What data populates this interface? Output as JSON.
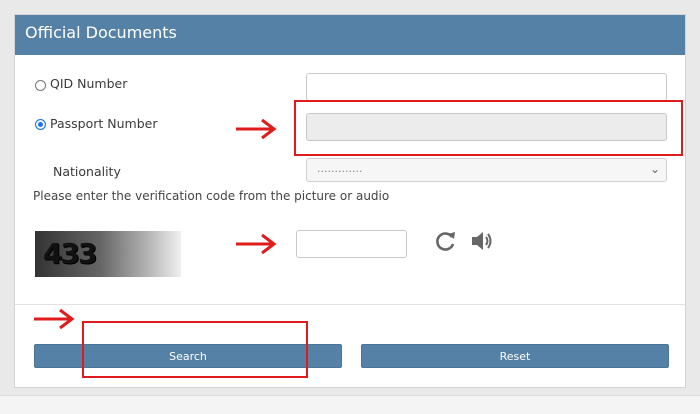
{
  "header": {
    "title": "Official Documents"
  },
  "form": {
    "options": [
      {
        "label": "QID Number",
        "selected": false
      },
      {
        "label": "Passport Number",
        "selected": true
      }
    ],
    "nationality": {
      "label": "Nationality",
      "selected_value": "............."
    },
    "verification_hint": "Please enter the verification code from the picture or audio",
    "captcha_text": "433"
  },
  "icons": {
    "refresh": "refresh-icon",
    "audio": "speaker-icon"
  },
  "buttons": {
    "search": "Search",
    "reset": "Reset"
  },
  "colors": {
    "header": "#5581a6",
    "button": "#5581a6",
    "annotation": "#e01b1b"
  }
}
